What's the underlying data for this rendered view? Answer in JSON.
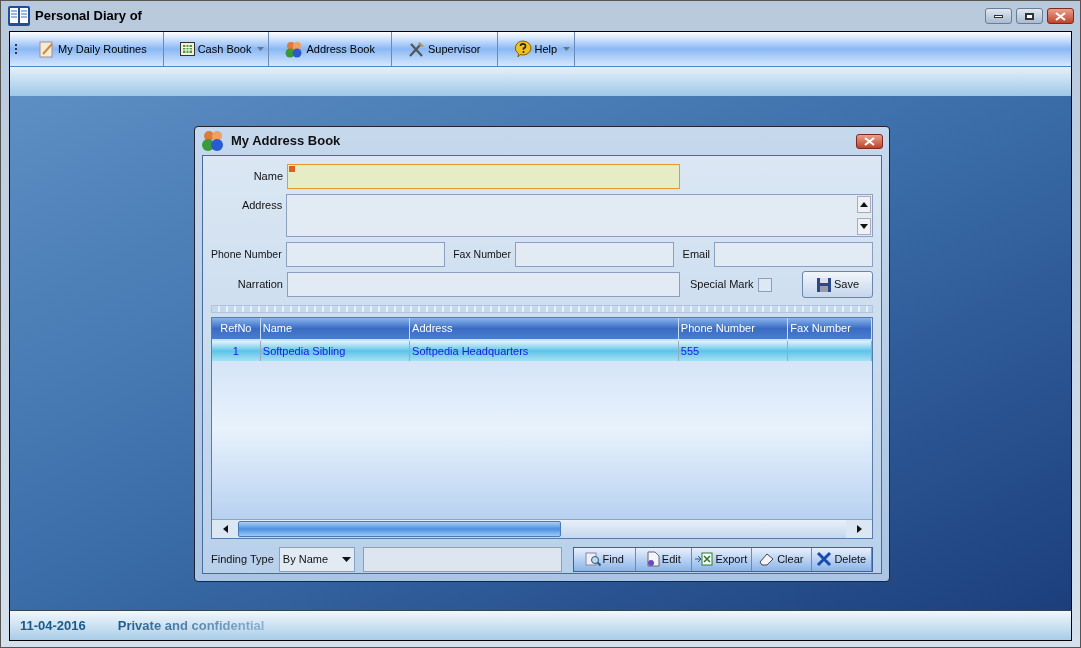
{
  "window": {
    "title": "Personal Diary of"
  },
  "toolbar": [
    {
      "label": "My Daily Routines",
      "dropdown": false
    },
    {
      "label": "Cash Book",
      "dropdown": true
    },
    {
      "label": "Address Book",
      "dropdown": false
    },
    {
      "label": "Supervisor",
      "dropdown": false
    },
    {
      "label": "Help",
      "dropdown": true
    }
  ],
  "dialog": {
    "title": "My Address Book",
    "form": {
      "name_label": "Name",
      "address_label": "Address",
      "phone_label": "Phone Number",
      "fax_label": "Fax Number",
      "email_label": "Email",
      "narration_label": "Narration",
      "special_mark": {
        "label": "Special Mark",
        "checked": false
      },
      "save_button": "Save"
    },
    "table": {
      "columns": [
        "RefNo",
        "Name",
        "Address",
        "Phone Number",
        "Fax Number"
      ],
      "rows": [
        {
          "cells": [
            "1",
            "Softpedia Sibling",
            "Softpedia Headquarters",
            "555",
            ""
          ],
          "selected": true
        }
      ]
    },
    "finding_type": {
      "label": "Finding Type",
      "value": "By Name"
    },
    "buttons": [
      "Find",
      "Edit",
      "Export",
      "Clear",
      "Delete"
    ]
  },
  "status_bar": {
    "date": "11-04-2016",
    "note": "Private and confidential"
  }
}
